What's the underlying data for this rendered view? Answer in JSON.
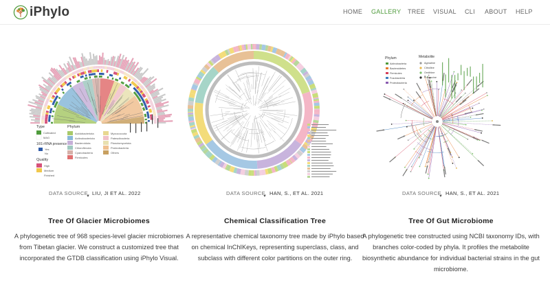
{
  "header": {
    "brand": "iPhylo",
    "nav": [
      {
        "label": "HOME",
        "active": false
      },
      {
        "label": "GALLERY",
        "active": true
      },
      {
        "label": "TREE",
        "active": false
      },
      {
        "label": "VISUAL",
        "active": false
      },
      {
        "label": "CLI",
        "active": false
      },
      {
        "label": "ABOUT",
        "active": false
      },
      {
        "label": "HELP",
        "active": false
      }
    ]
  },
  "colors": {
    "accent": "#4f9b3c",
    "nav_text": "#666666",
    "title_text": "#222222"
  },
  "gallery": [
    {
      "source_label": "DATA SOURCE",
      "source": "LIU, JI ET AL. 2022",
      "title": "Tree Of Glacier Microbiomes",
      "description": "A phylogenetic tree of 968 species-level glacier microbiomes from Tibetan glacier. We construct a customized tree that incorporated the GTDB classification using iPhylo Visual.",
      "legend": {
        "type_title": "Type",
        "type_items": [
          "Cultivated",
          "MAG"
        ],
        "rna_title": "16S rRNA presence",
        "rna_items": [
          "Yes",
          "No"
        ],
        "quality_title": "Quality",
        "quality_items": [
          "High",
          "Medium",
          "Finished"
        ],
        "phylum_title": "Phylum",
        "phylum_items": [
          "Acidobacteriota",
          "Actinobacteriota",
          "Bacteroidota",
          "Chloroflexota",
          "Cyanobacteria",
          "Firmicutes",
          "Myxococcota",
          "Patescibacteria",
          "Planctomycetota",
          "Proteobacteria",
          "Others"
        ]
      }
    },
    {
      "source_label": "DATA SOURCE",
      "source": "HAN, S., ET AL. 2021",
      "title": "Chemical Classification Tree",
      "description": "A representative chemical taxonomy tree made by iPhylo based on chemical InChIKeys, representing superclass, class, and subclass with different color partitions on the outer ring."
    },
    {
      "source_label": "DATA SOURCE",
      "source": "HAN, S., ET AL. 2021",
      "title": "Tree Of Gut Microbiome",
      "description": "A phylogenetic tree constructed using NCBI taxonomy IDs, with branches color-coded by phyla. It profiles the metabolite biosynthetic abundance for individual bacterial strains in the gut microbiome.",
      "legend": {
        "phylum_title": "Phylum",
        "phylum_items": [
          "Actinobacteria",
          "Bacteroidetes",
          "Firmicutes",
          "Fusobacteria",
          "Proteobacteria"
        ],
        "metabolite_title": "Metabolite",
        "metabolite_items": [
          "Agmatine",
          "Citrulline",
          "Ornithine",
          "Putrescine"
        ]
      }
    }
  ]
}
